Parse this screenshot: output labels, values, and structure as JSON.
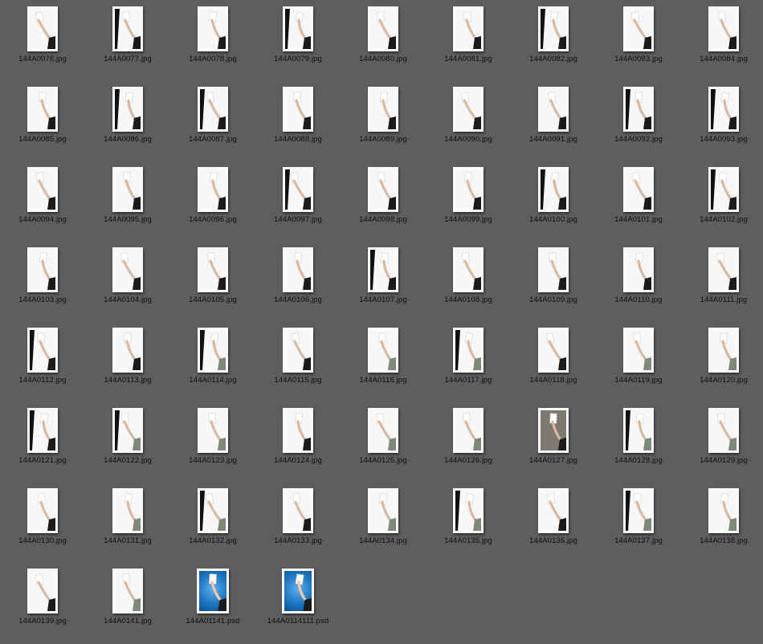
{
  "files": [
    {
      "name": "144A0076.jpg",
      "icon": "photo-thumbnail-icon"
    },
    {
      "name": "144A0077.jpg",
      "icon": "photo-thumbnail-icon"
    },
    {
      "name": "144A0078.jpg",
      "icon": "photo-thumbnail-icon"
    },
    {
      "name": "144A0079.jpg",
      "icon": "photo-thumbnail-icon"
    },
    {
      "name": "144A0080.jpg",
      "icon": "photo-thumbnail-icon"
    },
    {
      "name": "144A0081.jpg",
      "icon": "photo-thumbnail-icon"
    },
    {
      "name": "144A0082.jpg",
      "icon": "photo-thumbnail-icon"
    },
    {
      "name": "144A0083.jpg",
      "icon": "photo-thumbnail-icon"
    },
    {
      "name": "144A0084.jpg",
      "icon": "photo-thumbnail-icon"
    },
    {
      "name": "144A0085.jpg",
      "icon": "photo-thumbnail-icon"
    },
    {
      "name": "144A0086.jpg",
      "icon": "photo-thumbnail-icon"
    },
    {
      "name": "144A0087.jpg",
      "icon": "photo-thumbnail-icon"
    },
    {
      "name": "144A0088.jpg",
      "icon": "photo-thumbnail-icon"
    },
    {
      "name": "144A0089.jpg",
      "icon": "photo-thumbnail-icon"
    },
    {
      "name": "144A0090.jpg",
      "icon": "photo-thumbnail-icon"
    },
    {
      "name": "144A0091.jpg",
      "icon": "photo-thumbnail-icon"
    },
    {
      "name": "144A0092.jpg",
      "icon": "photo-thumbnail-icon"
    },
    {
      "name": "144A0093.jpg",
      "icon": "photo-thumbnail-icon"
    },
    {
      "name": "144A0094.jpg",
      "icon": "photo-thumbnail-icon"
    },
    {
      "name": "144A0095.jpg",
      "icon": "photo-thumbnail-icon"
    },
    {
      "name": "144A0096.jpg",
      "icon": "photo-thumbnail-icon"
    },
    {
      "name": "144A0097.jpg",
      "icon": "photo-thumbnail-icon"
    },
    {
      "name": "144A0098.jpg",
      "icon": "photo-thumbnail-icon"
    },
    {
      "name": "144A0099.jpg",
      "icon": "photo-thumbnail-icon"
    },
    {
      "name": "144A0100.jpg",
      "icon": "photo-thumbnail-icon"
    },
    {
      "name": "144A0101.jpg",
      "icon": "photo-thumbnail-icon"
    },
    {
      "name": "144A0102.jpg",
      "icon": "photo-thumbnail-icon"
    },
    {
      "name": "144A0103.jpg",
      "icon": "photo-thumbnail-icon"
    },
    {
      "name": "144A0104.jpg",
      "icon": "photo-thumbnail-icon"
    },
    {
      "name": "144A0105.jpg",
      "icon": "photo-thumbnail-icon"
    },
    {
      "name": "144A0106.jpg",
      "icon": "photo-thumbnail-icon"
    },
    {
      "name": "144A0107.jpg",
      "icon": "photo-thumbnail-icon"
    },
    {
      "name": "144A0108.jpg",
      "icon": "photo-thumbnail-icon"
    },
    {
      "name": "144A0109.jpg",
      "icon": "photo-thumbnail-icon"
    },
    {
      "name": "144A0110.jpg",
      "icon": "photo-thumbnail-icon"
    },
    {
      "name": "144A0111.jpg",
      "icon": "photo-thumbnail-icon"
    },
    {
      "name": "144A0112.jpg",
      "icon": "photo-thumbnail-icon"
    },
    {
      "name": "144A0113.jpg",
      "icon": "photo-thumbnail-icon"
    },
    {
      "name": "144A0114.jpg",
      "icon": "photo-thumbnail-icon"
    },
    {
      "name": "144A0115.jpg",
      "icon": "photo-thumbnail-icon"
    },
    {
      "name": "144A0116.jpg",
      "icon": "photo-thumbnail-icon"
    },
    {
      "name": "144A0117.jpg",
      "icon": "photo-thumbnail-icon"
    },
    {
      "name": "144A0118.jpg",
      "icon": "photo-thumbnail-icon"
    },
    {
      "name": "144A0119.jpg",
      "icon": "photo-thumbnail-icon"
    },
    {
      "name": "144A0120.jpg",
      "icon": "photo-thumbnail-icon"
    },
    {
      "name": "144A0121.jpg",
      "icon": "photo-thumbnail-icon"
    },
    {
      "name": "144A0122.jpg",
      "icon": "photo-thumbnail-icon"
    },
    {
      "name": "144A0123.jpg",
      "icon": "photo-thumbnail-icon"
    },
    {
      "name": "144A0124.jpg",
      "icon": "photo-thumbnail-icon"
    },
    {
      "name": "144A0125.jpg",
      "icon": "photo-thumbnail-icon"
    },
    {
      "name": "144A0126.jpg",
      "icon": "photo-thumbnail-icon"
    },
    {
      "name": "144A0127.jpg",
      "icon": "photo-thumbnail-icon"
    },
    {
      "name": "144A0128.jpg",
      "icon": "photo-thumbnail-icon"
    },
    {
      "name": "144A0129.jpg",
      "icon": "photo-thumbnail-icon"
    },
    {
      "name": "144A0130.jpg",
      "icon": "photo-thumbnail-icon"
    },
    {
      "name": "144A0131.jpg",
      "icon": "photo-thumbnail-icon"
    },
    {
      "name": "144A0132.jpg",
      "icon": "photo-thumbnail-icon"
    },
    {
      "name": "144A0133.jpg",
      "icon": "photo-thumbnail-icon"
    },
    {
      "name": "144A0134.jpg",
      "icon": "photo-thumbnail-icon"
    },
    {
      "name": "144A0135.jpg",
      "icon": "photo-thumbnail-icon"
    },
    {
      "name": "144A0136.jpg",
      "icon": "photo-thumbnail-icon"
    },
    {
      "name": "144A0137.jpg",
      "icon": "photo-thumbnail-icon"
    },
    {
      "name": "144A0138.jpg",
      "icon": "photo-thumbnail-icon"
    },
    {
      "name": "144A0139.jpg",
      "icon": "photo-thumbnail-icon"
    },
    {
      "name": "144A0141.jpg",
      "icon": "photo-thumbnail-icon"
    },
    {
      "name": "144A01141.psd",
      "icon": "psd-thumbnail-icon"
    },
    {
      "name": "144A0114111.psd",
      "icon": "psd-thumbnail-icon"
    }
  ],
  "colors": {
    "background": "#5e5e5e",
    "label_text": "#0d0d0d",
    "psd_blue": "#1f78c4"
  }
}
